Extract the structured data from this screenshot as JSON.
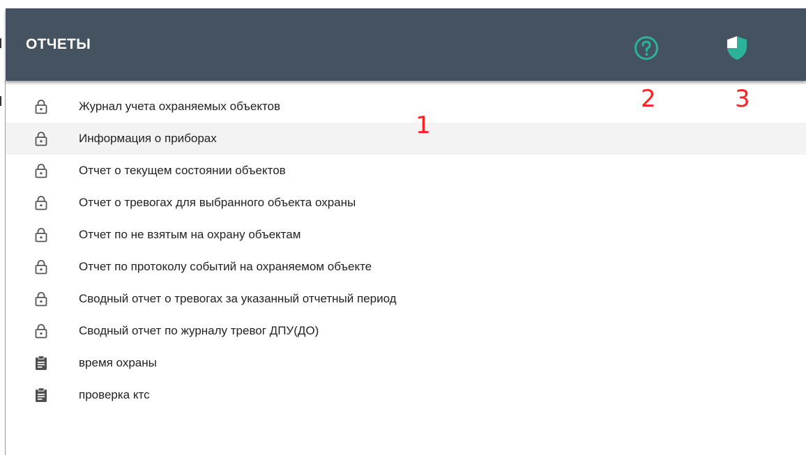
{
  "header": {
    "title": "ОТЧЕТЫ",
    "accent_color": "#2bb39a",
    "background_color": "#45525f"
  },
  "reports": [
    {
      "label": "Журнал учета охраняемых объектов",
      "icon": "lock-icon"
    },
    {
      "label": "Информация о приборах",
      "icon": "lock-icon",
      "highlighted": true
    },
    {
      "label": "Отчет о текущем состоянии объектов",
      "icon": "lock-icon"
    },
    {
      "label": "Отчет о тревогах для выбранного объекта охраны",
      "icon": "lock-icon"
    },
    {
      "label": "Отчет по не взятым на охрану объектам",
      "icon": "lock-icon"
    },
    {
      "label": "Отчет по протоколу событий на охраняемом объекте",
      "icon": "lock-icon"
    },
    {
      "label": "Сводный отчет о тревогах за указанный отчетный период",
      "icon": "lock-icon"
    },
    {
      "label": "Сводный отчет по журналу тревог ДПУ(ДО)",
      "icon": "lock-icon"
    },
    {
      "label": "время охраны",
      "icon": "clipboard-icon"
    },
    {
      "label": "проверка ктс",
      "icon": "clipboard-icon"
    }
  ],
  "annotations": {
    "list_marker": "1",
    "help_marker": "2",
    "security_marker": "3"
  }
}
